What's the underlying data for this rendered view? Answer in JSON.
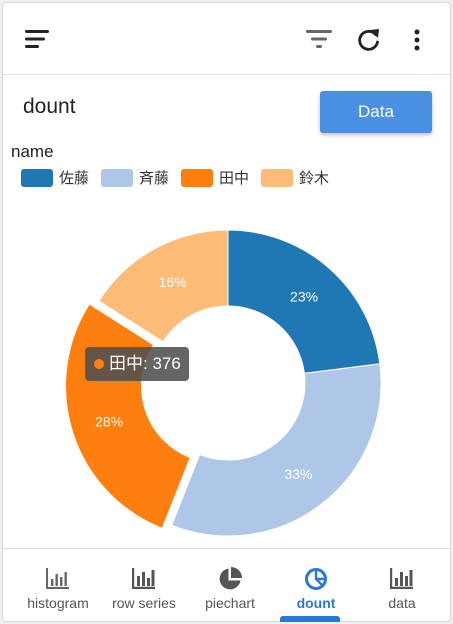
{
  "header": {
    "title": "dount",
    "data_button_label": "Data"
  },
  "legend": {
    "title": "name",
    "items": [
      {
        "label": "佐藤",
        "color": "#1f77b4"
      },
      {
        "label": "斉藤",
        "color": "#aec7e8"
      },
      {
        "label": "田中",
        "color": "#ff7f0e"
      },
      {
        "label": "鈴木",
        "color": "#ffbb78"
      }
    ]
  },
  "chart_data": {
    "type": "pie",
    "variant": "donut",
    "categories": [
      "佐藤",
      "斉藤",
      "田中",
      "鈴木"
    ],
    "values": [
      23,
      33,
      28,
      16
    ],
    "labels": [
      "23%",
      "33%",
      "28%",
      "16%"
    ],
    "colors": [
      "#1f77b4",
      "#aec7e8",
      "#ff7f0e",
      "#ffbb78"
    ],
    "highlighted": "田中",
    "legend_position": "top-left"
  },
  "tooltip": {
    "text": "田中: 376",
    "color": "#ff7f0e"
  },
  "nav": {
    "items": [
      {
        "label": "histogram",
        "icon": "bar-chart-icon"
      },
      {
        "label": "row series",
        "icon": "bar-chart-icon"
      },
      {
        "label": "piechart",
        "icon": "pie-chart-icon"
      },
      {
        "label": "dount",
        "icon": "donut-chart-icon",
        "active": true
      },
      {
        "label": "data",
        "icon": "bar-chart-icon"
      }
    ]
  }
}
